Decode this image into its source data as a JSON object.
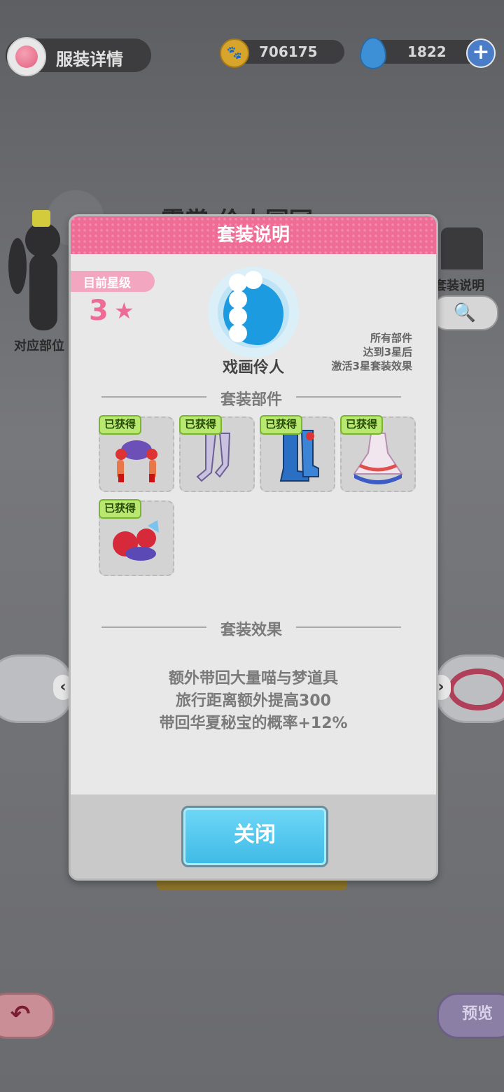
{
  "topbar": {
    "title": "服装详情",
    "coins": "706175",
    "gems": "1822",
    "plus_label": "+"
  },
  "background": {
    "outfit_title": "霓裳·伶人国冠",
    "left_label": "对应部位",
    "right_label": "套装说明"
  },
  "panel": {
    "header": "套装说明",
    "star_tag": "目前星级",
    "star_level": "3",
    "set_name": "戏画伶人",
    "note_lines": [
      "所有部件",
      "达到3星后",
      "激活3星套装效果"
    ],
    "parts_title": "套装部件",
    "effects_title": "套装效果",
    "items": [
      {
        "badge": "已获得",
        "name": "headdress"
      },
      {
        "badge": "已获得",
        "name": "stockings"
      },
      {
        "badge": "已获得",
        "name": "boots"
      },
      {
        "badge": "已获得",
        "name": "dress"
      },
      {
        "badge": "已获得",
        "name": "accessory"
      }
    ],
    "effects": [
      "额外带回大量喵与梦道具",
      "旅行距离额外提高300",
      "带回华夏秘宝的概率+12%"
    ],
    "close_label": "关闭"
  },
  "bottom": {
    "back_label": "↶",
    "preview_label": "预览"
  },
  "colors": {
    "accent_pink": "#ef6c97",
    "badge_green": "#b8e86f",
    "close_blue": "#3ebae6"
  }
}
